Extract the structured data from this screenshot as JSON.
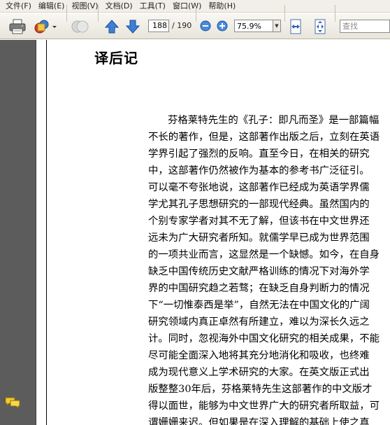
{
  "menu": {
    "items": [
      "文件(F)",
      "编辑(E)",
      "视图(V)",
      "文档(D)",
      "工具(T)",
      "窗口(W)",
      "帮助(H)"
    ]
  },
  "toolbar": {
    "current_page": "188",
    "page_total": "/ 190",
    "zoom_value": "75.9%",
    "search_placeholder": "查找"
  },
  "document": {
    "heading": "译后记",
    "lines": [
      "芬格莱特先生的《孔子：即凡而圣》是一部篇幅",
      "不长的著作，但是，这部著作出版之后，立刻在英语",
      "学界引起了强烈的反响。直至今日，在相关的研究",
      "中，这部著作仍然被作为基本的参考书广泛征引。",
      "可以毫不夸张地说，这部著作已经成为英语学界儒",
      "学尤其孔子思想研究的一部现代经典。虽然国内的",
      "个别专家学者对其不无了解，但该书在中文世界还",
      "远未为广大研究者所知。就儒学早已成为世界范围",
      "的一项共业而言，这显然是一个缺憾。如今，在自身",
      "缺乏中国传统历史文献严格训练的情况下对海外学",
      "界的中国研究趋之若骛；在缺乏自身判断力的情况",
      "下“一切惟泰西是举”，自然无法在中国文化的广阔",
      "研究领域内真正卓然有所建立，难以为深长久远之",
      "计。同时，忽视海外中国文化研究的相关成果，不能",
      "尽可能全面深入地将其充分地消化和吸收，也终难",
      "成为现代意义上学术研究的大家。在英文版正式出",
      "版整整30年后，芬格莱特先生这部著作的中文版才",
      "得以面世，能够为中文世界广大的研究者所取益，可",
      "谓姗姗来迟。但如果是在深入理解的基础上使之真"
    ]
  }
}
